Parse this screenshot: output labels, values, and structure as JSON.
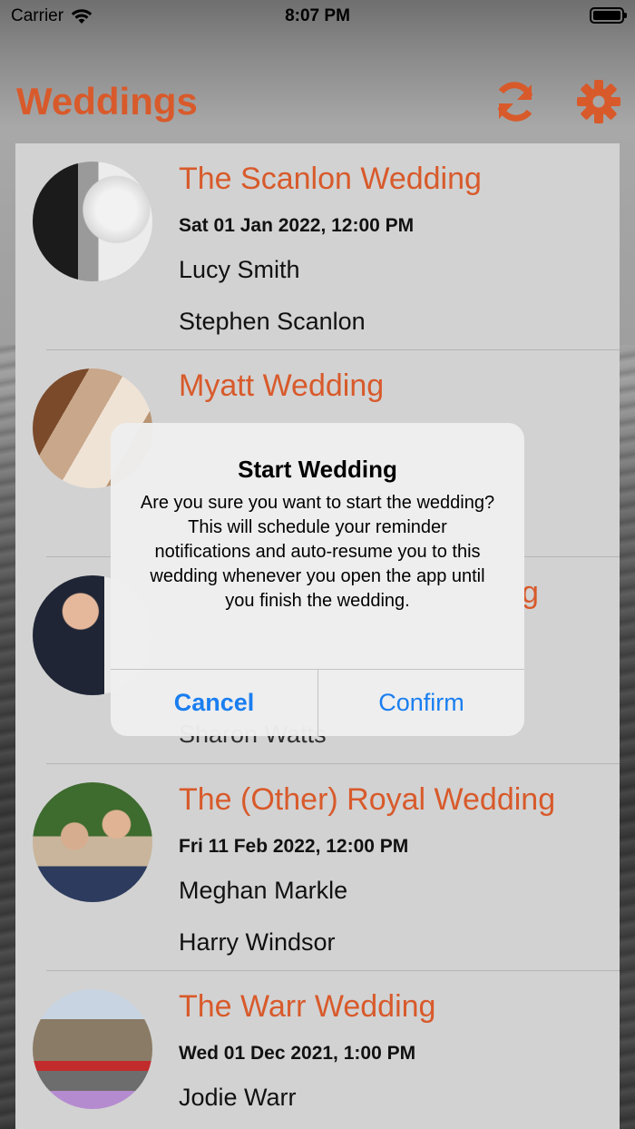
{
  "status_bar": {
    "carrier": "Carrier",
    "time": "8:07 PM"
  },
  "header": {
    "title": "Weddings",
    "refresh_icon": "refresh-icon",
    "settings_icon": "gear-icon"
  },
  "weddings": [
    {
      "name": "The Scanlon Wedding",
      "date": "Sat 01 Jan 2022, 12:00 PM",
      "person1": "Lucy Smith",
      "person2": "Stephen Scanlon"
    },
    {
      "name": "Myatt Wedding",
      "date": "",
      "person1": "",
      "person2": ""
    },
    {
      "name": "",
      "name_visible_suffix": "g",
      "date": "",
      "person1": "",
      "person2": "Sharon Watts"
    },
    {
      "name": "The (Other) Royal Wedding",
      "date": "Fri 11 Feb 2022, 12:00 PM",
      "person1": "Meghan Markle",
      "person2": "Harry Windsor"
    },
    {
      "name": "The Warr Wedding",
      "date": "Wed 01 Dec 2021, 1:00 PM",
      "person1": "Jodie Warr",
      "person2": ""
    }
  ],
  "dialog": {
    "title": "Start Wedding",
    "message": "Are you sure you want to start the wedding? This will schedule your reminder notifications and auto-resume you to this wedding whenever you open the app until you finish the wedding.",
    "cancel_label": "Cancel",
    "confirm_label": "Confirm"
  },
  "colors": {
    "accent": "#d85a2b",
    "button_blue": "#1a7ef0"
  }
}
